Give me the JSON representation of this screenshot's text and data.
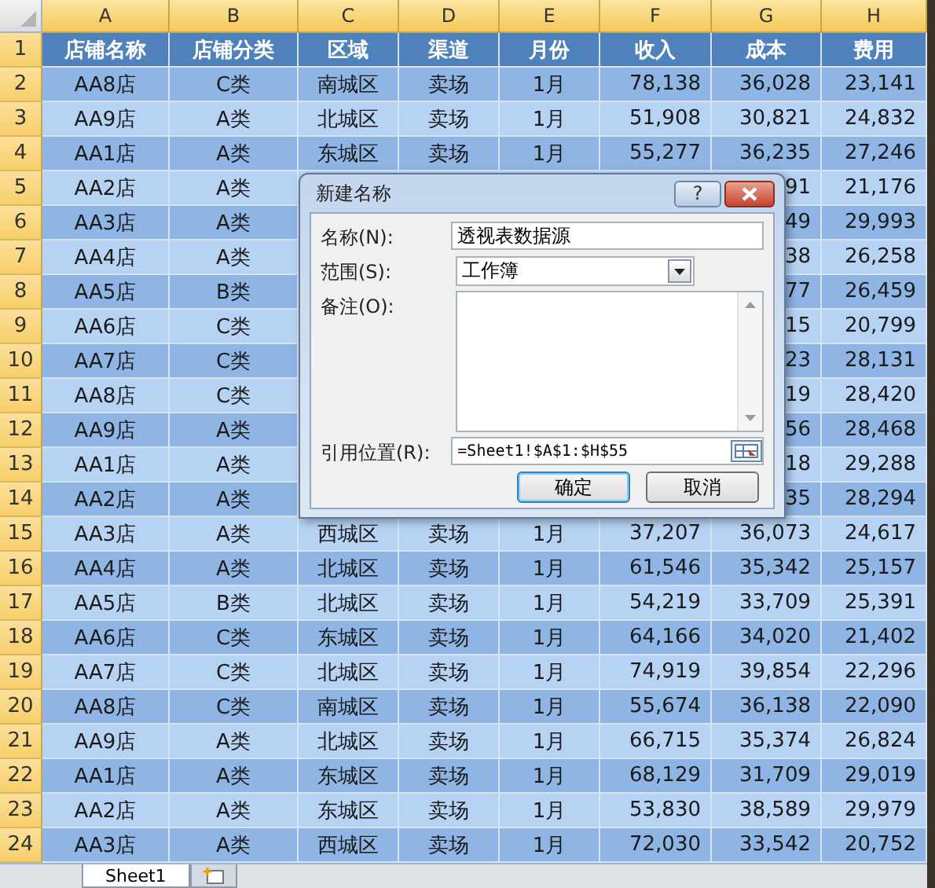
{
  "columns": [
    "A",
    "B",
    "C",
    "D",
    "E",
    "F",
    "G",
    "H"
  ],
  "rows": [
    {
      "number": "1",
      "kind": "header",
      "cells": [
        "店铺名称",
        "店铺分类",
        "区域",
        "渠道",
        "月份",
        "收入",
        "成本",
        "费用"
      ]
    },
    {
      "number": "2",
      "kind": "data",
      "cells": [
        "AA8店",
        "C类",
        "南城区",
        "卖场",
        "1月",
        "78,138",
        "36,028",
        "23,141"
      ]
    },
    {
      "number": "3",
      "kind": "data",
      "cells": [
        "AA9店",
        "A类",
        "北城区",
        "卖场",
        "1月",
        "51,908",
        "30,821",
        "24,832"
      ]
    },
    {
      "number": "4",
      "kind": "data",
      "cells": [
        "AA1店",
        "A类",
        "东城区",
        "卖场",
        "1月",
        "55,277",
        "36,235",
        "27,246"
      ]
    },
    {
      "number": "5",
      "kind": "data",
      "cells": [
        "AA2店",
        "A类",
        null,
        null,
        null,
        null,
        "91",
        "21,176"
      ]
    },
    {
      "number": "6",
      "kind": "data",
      "cells": [
        "AA3店",
        "A类",
        null,
        null,
        null,
        null,
        "49",
        "29,993"
      ]
    },
    {
      "number": "7",
      "kind": "data",
      "cells": [
        "AA4店",
        "A类",
        null,
        null,
        null,
        null,
        "38",
        "26,258"
      ]
    },
    {
      "number": "8",
      "kind": "data",
      "cells": [
        "AA5店",
        "B类",
        null,
        null,
        null,
        null,
        "77",
        "26,459"
      ]
    },
    {
      "number": "9",
      "kind": "data",
      "cells": [
        "AA6店",
        "C类",
        null,
        null,
        null,
        null,
        "15",
        "20,799"
      ]
    },
    {
      "number": "10",
      "kind": "data",
      "cells": [
        "AA7店",
        "C类",
        null,
        null,
        null,
        null,
        "23",
        "28,131"
      ]
    },
    {
      "number": "11",
      "kind": "data",
      "cells": [
        "AA8店",
        "C类",
        null,
        null,
        null,
        null,
        "19",
        "28,420"
      ]
    },
    {
      "number": "12",
      "kind": "data",
      "cells": [
        "AA9店",
        "A类",
        null,
        null,
        null,
        null,
        "56",
        "28,468"
      ]
    },
    {
      "number": "13",
      "kind": "data",
      "cells": [
        "AA1店",
        "A类",
        null,
        null,
        null,
        null,
        "18",
        "29,288"
      ]
    },
    {
      "number": "14",
      "kind": "data",
      "cells": [
        "AA2店",
        "A类",
        null,
        null,
        null,
        null,
        "35",
        "28,294"
      ]
    },
    {
      "number": "15",
      "kind": "data",
      "cells": [
        "AA3店",
        "A类",
        "西城区",
        "卖场",
        "1月",
        "37,207",
        "36,073",
        "24,617"
      ]
    },
    {
      "number": "16",
      "kind": "data",
      "cells": [
        "AA4店",
        "A类",
        "北城区",
        "卖场",
        "1月",
        "61,546",
        "35,342",
        "25,157"
      ]
    },
    {
      "number": "17",
      "kind": "data",
      "cells": [
        "AA5店",
        "B类",
        "北城区",
        "卖场",
        "1月",
        "54,219",
        "33,709",
        "25,391"
      ]
    },
    {
      "number": "18",
      "kind": "data",
      "cells": [
        "AA6店",
        "C类",
        "东城区",
        "卖场",
        "1月",
        "64,166",
        "34,020",
        "21,402"
      ]
    },
    {
      "number": "19",
      "kind": "data",
      "cells": [
        "AA7店",
        "C类",
        "北城区",
        "卖场",
        "1月",
        "74,919",
        "39,854",
        "22,296"
      ]
    },
    {
      "number": "20",
      "kind": "data",
      "cells": [
        "AA8店",
        "C类",
        "南城区",
        "卖场",
        "1月",
        "55,674",
        "36,138",
        "22,090"
      ]
    },
    {
      "number": "21",
      "kind": "data",
      "cells": [
        "AA9店",
        "A类",
        "北城区",
        "卖场",
        "1月",
        "66,715",
        "35,374",
        "26,824"
      ]
    },
    {
      "number": "22",
      "kind": "data",
      "cells": [
        "AA1店",
        "A类",
        "东城区",
        "卖场",
        "1月",
        "68,129",
        "31,709",
        "29,019"
      ]
    },
    {
      "number": "23",
      "kind": "data",
      "cells": [
        "AA2店",
        "A类",
        "东城区",
        "卖场",
        "1月",
        "53,830",
        "38,589",
        "29,979"
      ]
    },
    {
      "number": "24",
      "kind": "data",
      "cells": [
        "AA3店",
        "A类",
        "西城区",
        "卖场",
        "1月",
        "72,030",
        "33,542",
        "20,752"
      ]
    }
  ],
  "dialog": {
    "title": "新建名称",
    "help_button": "?",
    "fields": [
      {
        "kind": "text",
        "label": "名称(N):",
        "value": "透视表数据源"
      },
      {
        "kind": "select",
        "label": "范围(S):",
        "value": "工作簿"
      },
      {
        "kind": "textarea",
        "label": "备注(O):"
      },
      {
        "kind": "reference",
        "label": "引用位置(R):",
        "value": "=Sheet1!$A$1:$H$55"
      }
    ],
    "buttons": [
      {
        "label": "确定",
        "default": true
      },
      {
        "label": "取消",
        "default": false
      }
    ]
  },
  "sheet_tabs": [
    {
      "label": "Sheet1",
      "selected": true
    }
  ]
}
